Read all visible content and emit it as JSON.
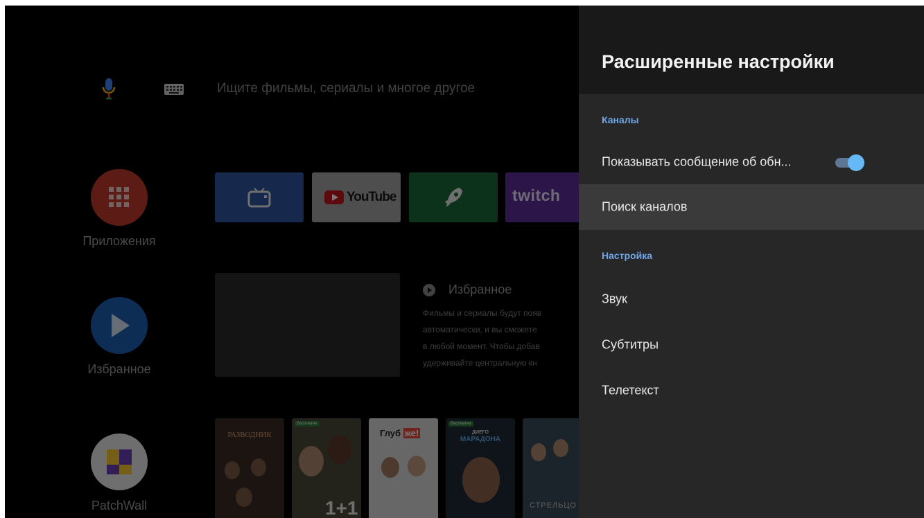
{
  "search": {
    "placeholder": "Ищите фильмы, сериалы и многое другое"
  },
  "side_buttons": [
    {
      "label": "Приложения",
      "color": "#c0392b",
      "icon": "apps-grid-icon"
    },
    {
      "label": "Избранное",
      "color": "#1f5fb0",
      "icon": "play-icon"
    },
    {
      "label": "PatchWall",
      "color": "#e6e6e6",
      "icon": "patchwall-logo-icon"
    }
  ],
  "app_tiles": [
    {
      "name": "tv",
      "icon": "tv-icon",
      "color": "#2f56a0"
    },
    {
      "name": "YouTube",
      "label": "YouTube",
      "color": "#a3a3a3"
    },
    {
      "name": "rocket",
      "icon": "rocket-icon",
      "color": "#1d6a3a"
    },
    {
      "name": "twitch",
      "label": "twitch",
      "color": "#5b2c9a"
    }
  ],
  "favorites": {
    "title": "Избранное",
    "description_lines": [
      "Фильмы и сериалы будут появ",
      "автоматически, и вы сможете",
      "в любой момент. Чтобы добав",
      "удерживайте центральную кн"
    ]
  },
  "posters": [
    {
      "title": "РАЗВОДНИК",
      "color": "#3a2a22"
    },
    {
      "badge": "Бесплатно",
      "big": "1+1",
      "color": "#4a4a3a"
    },
    {
      "title_prefix": "Глуб",
      "title_highlight": "же!",
      "color": "#d8d8d8"
    },
    {
      "badge": "Бесплатно",
      "title_top": "ДИЕГО",
      "title_bottom": "МАРАДОНА",
      "color": "#1f2a38"
    },
    {
      "title": "СТРЕЛЬЦО",
      "color": "#3a4a5a"
    }
  ],
  "panel": {
    "title": "Расширенные настройки",
    "section_channels": "Каналы",
    "show_update_message": "Показывать сообщение об обн...",
    "toggle_on": true,
    "channel_search": "Поиск каналов",
    "section_setup": "Настройка",
    "sound": "Звук",
    "subtitles": "Субтитры",
    "teletext": "Телетекст"
  }
}
